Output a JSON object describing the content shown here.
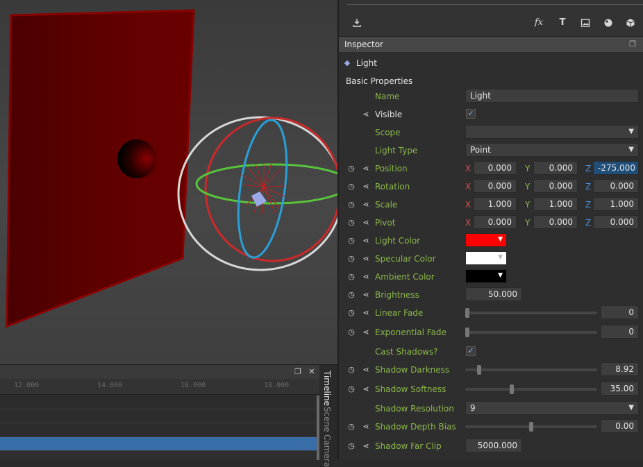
{
  "timeline": {
    "ruler": [
      "12.000",
      "14.000",
      "16.000",
      "18.000"
    ],
    "tabs": [
      "Timeline",
      "Scene",
      "Camera"
    ]
  },
  "toolbar": {
    "icons": [
      "download-icon",
      "fx-icon",
      "text-icon",
      "image-icon",
      "sphere-icon",
      "cube-icon"
    ],
    "fx_glyph": "fx",
    "text_glyph": "T"
  },
  "inspector": {
    "title": "Inspector",
    "object_name": "Light",
    "section": "Basic Properties",
    "name_label": "Name",
    "name_value": "Light",
    "visible_label": "Visible",
    "scope_label": "Scope",
    "scope_value": "",
    "light_type_label": "Light Type",
    "light_type_value": "Point",
    "axes": {
      "x": "X",
      "y": "Y",
      "z": "Z"
    },
    "position": {
      "label": "Position",
      "x": "0.000",
      "y": "0.000",
      "z": "-275.000"
    },
    "rotation": {
      "label": "Rotation",
      "x": "0.000",
      "y": "0.000",
      "z": "0.000"
    },
    "scale": {
      "label": "Scale",
      "x": "1.000",
      "y": "1.000",
      "z": "1.000"
    },
    "pivot": {
      "label": "Pivot",
      "x": "0.000",
      "y": "0.000",
      "z": "0.000"
    },
    "light_color": {
      "label": "Light Color",
      "color": "#ff0000"
    },
    "specular_color": {
      "label": "Specular Color",
      "color": "#ffffff"
    },
    "ambient_color": {
      "label": "Ambient Color",
      "color": "#000000"
    },
    "brightness": {
      "label": "Brightness",
      "value": "50.000"
    },
    "linear_fade": {
      "label": "Linear Fade",
      "value": "0",
      "level": 0
    },
    "exponential_fade": {
      "label": "Exponential Fade",
      "value": "0",
      "level": 0
    },
    "cast_shadows_label": "Cast Shadows?",
    "shadow_darkness": {
      "label": "Shadow Darkness",
      "value": "8.92",
      "level": 0.09
    },
    "shadow_softness": {
      "label": "Shadow Softness",
      "value": "35.00",
      "level": 0.35
    },
    "shadow_resolution": {
      "label": "Shadow Resolution",
      "value": "9"
    },
    "shadow_depth_bias": {
      "label": "Shadow Depth Bias",
      "value": "0.00",
      "level": 0.5
    },
    "shadow_far_clip": {
      "label": "Shadow Far Clip",
      "value": "5000.000"
    }
  }
}
